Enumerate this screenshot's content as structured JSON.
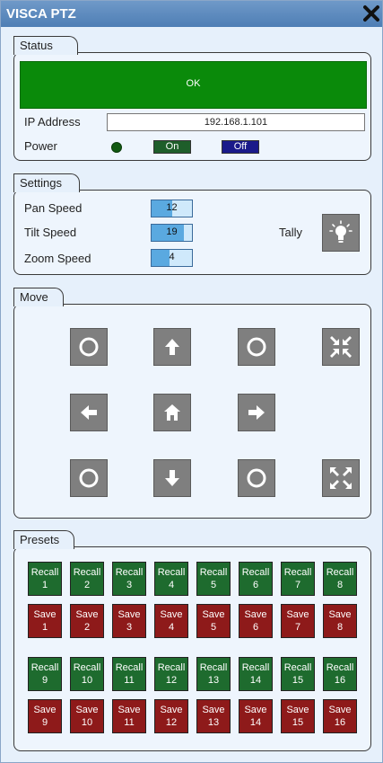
{
  "window": {
    "title": "VISCA PTZ"
  },
  "status": {
    "group_label": "Status",
    "state_text": "OK",
    "state_color": "#0a8a0a",
    "ip_label": "IP Address",
    "ip_value": "192.168.1.101",
    "power_label": "Power",
    "on_label": "On",
    "off_label": "Off"
  },
  "settings": {
    "group_label": "Settings",
    "pan_label": "Pan Speed",
    "pan_value": "12",
    "pan_fraction": 0.5,
    "tilt_label": "Tilt Speed",
    "tilt_value": "19",
    "tilt_fraction": 0.8,
    "zoom_label": "Zoom Speed",
    "zoom_value": "4",
    "zoom_fraction": 0.45,
    "tally_label": "Tally"
  },
  "move": {
    "group_label": "Move"
  },
  "presets": {
    "group_label": "Presets",
    "recall_prefix": "Recall",
    "save_prefix": "Save",
    "numbers": [
      "1",
      "2",
      "3",
      "4",
      "5",
      "6",
      "7",
      "8",
      "9",
      "10",
      "11",
      "12",
      "13",
      "14",
      "15",
      "16"
    ]
  }
}
